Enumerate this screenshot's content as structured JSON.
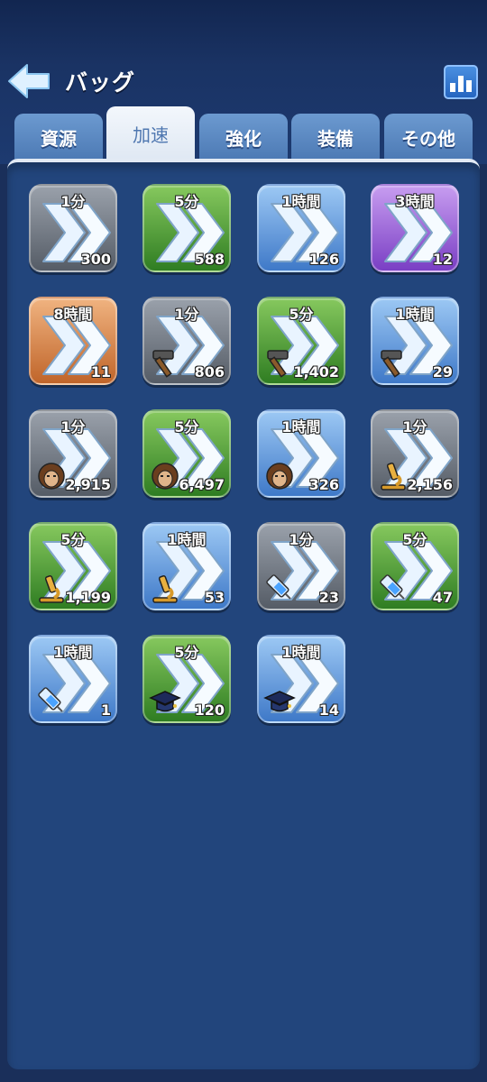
{
  "header": {
    "title": "バッグ"
  },
  "tabs": [
    "資源",
    "加速",
    "強化",
    "装備",
    "その他"
  ],
  "active_tab": "加速",
  "items": [
    {
      "duration": "1分",
      "count": "300",
      "rarity": "gray",
      "sub_icon": ""
    },
    {
      "duration": "5分",
      "count": "588",
      "rarity": "green",
      "sub_icon": ""
    },
    {
      "duration": "1時間",
      "count": "126",
      "rarity": "blue",
      "sub_icon": ""
    },
    {
      "duration": "3時間",
      "count": "12",
      "rarity": "purple",
      "sub_icon": ""
    },
    {
      "duration": "8時間",
      "count": "11",
      "rarity": "orange",
      "sub_icon": ""
    },
    {
      "duration": "1分",
      "count": "806",
      "rarity": "gray",
      "sub_icon": "hammer-icon"
    },
    {
      "duration": "5分",
      "count": "1,402",
      "rarity": "green",
      "sub_icon": "hammer-icon"
    },
    {
      "duration": "1時間",
      "count": "29",
      "rarity": "blue",
      "sub_icon": "hammer-icon"
    },
    {
      "duration": "1分",
      "count": "2,915",
      "rarity": "gray",
      "sub_icon": "soldier-icon"
    },
    {
      "duration": "5分",
      "count": "6,497",
      "rarity": "green",
      "sub_icon": "soldier-icon"
    },
    {
      "duration": "1時間",
      "count": "326",
      "rarity": "blue",
      "sub_icon": "soldier-icon"
    },
    {
      "duration": "1分",
      "count": "2,156",
      "rarity": "gray",
      "sub_icon": "microscope-icon"
    },
    {
      "duration": "5分",
      "count": "1,199",
      "rarity": "green",
      "sub_icon": "microscope-icon"
    },
    {
      "duration": "1時間",
      "count": "53",
      "rarity": "blue",
      "sub_icon": "microscope-icon"
    },
    {
      "duration": "1分",
      "count": "23",
      "rarity": "gray",
      "sub_icon": "syringe-icon"
    },
    {
      "duration": "5分",
      "count": "47",
      "rarity": "green",
      "sub_icon": "syringe-icon"
    },
    {
      "duration": "1時間",
      "count": "1",
      "rarity": "blue",
      "sub_icon": "syringe-icon"
    },
    {
      "duration": "5分",
      "count": "120",
      "rarity": "green",
      "sub_icon": "graduation-cap-icon"
    },
    {
      "duration": "1時間",
      "count": "14",
      "rarity": "blue",
      "sub_icon": "graduation-cap-icon"
    }
  ]
}
